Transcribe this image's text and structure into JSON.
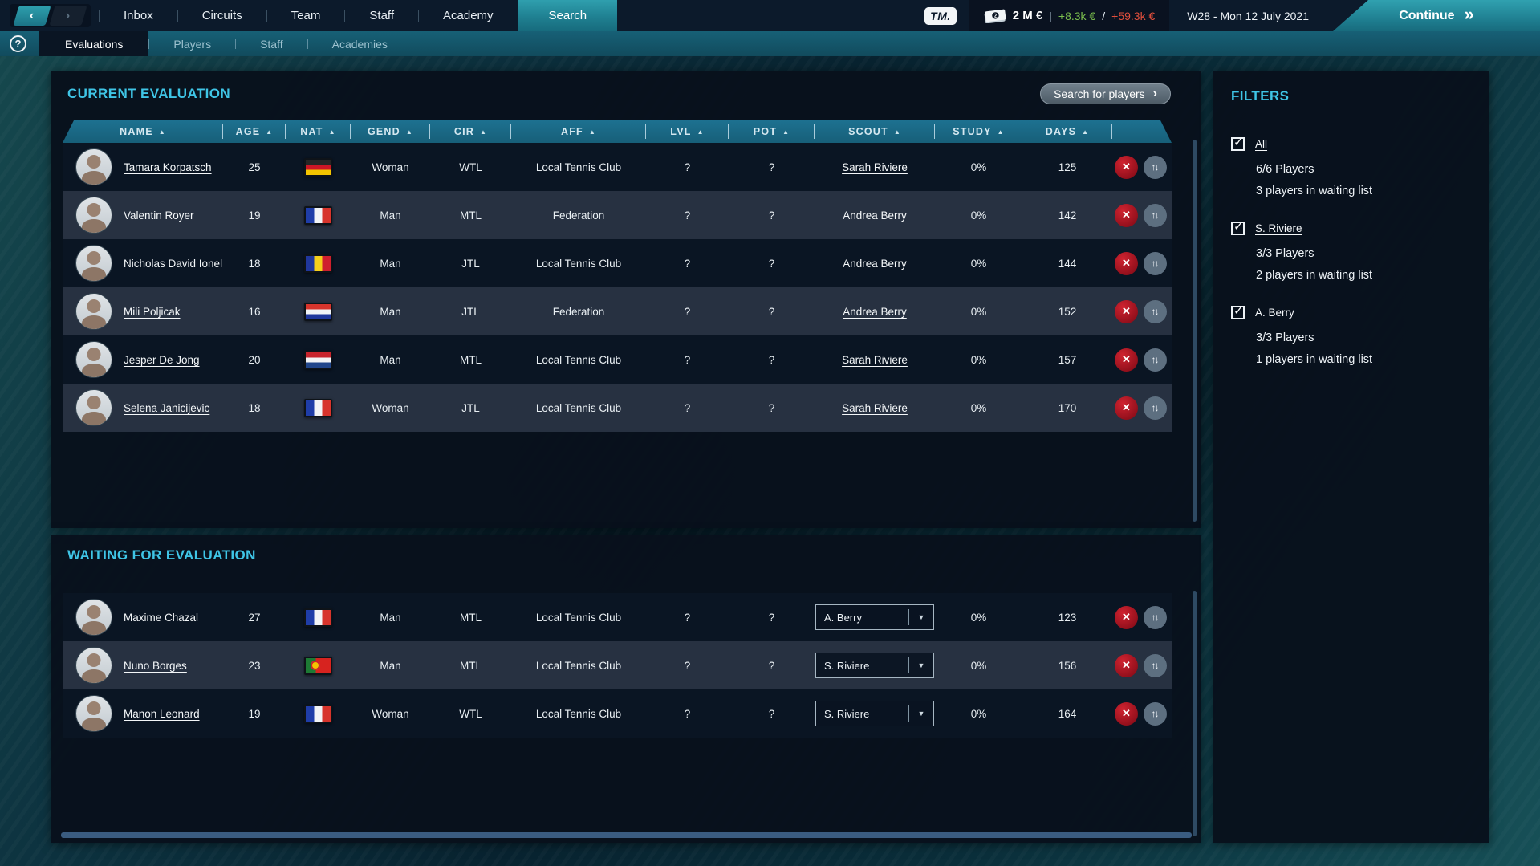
{
  "topbar": {
    "nav_items": [
      "Inbox",
      "Circuits",
      "Team",
      "Staff",
      "Academy",
      "Search"
    ],
    "active_nav": "Search",
    "logo_label": "TM.",
    "balance": "2 M €",
    "pipe": "|",
    "weekly_gain": "+8.3k €",
    "separator": "/",
    "weekly_loss": "+59.3k €",
    "date_label": "W28 - Mon 12 July 2021",
    "continue_label": "Continue",
    "continue_icon": "»",
    "back_icon": "‹",
    "forward_icon": "›"
  },
  "subnav": {
    "help_label": "?",
    "tabs": [
      "Evaluations",
      "Players",
      "Staff",
      "Academies"
    ],
    "active_tab": "Evaluations"
  },
  "current_evaluation": {
    "title": "CURRENT EVALUATION",
    "search_button_label": "Search for players",
    "search_button_icon": "›",
    "sort_icon": "▲",
    "columns": [
      "NAME",
      "AGE",
      "NAT",
      "GEND",
      "CIR",
      "AFF",
      "LVL",
      "POT",
      "SCOUT",
      "STUDY",
      "DAYS"
    ],
    "rows": [
      {
        "name": "Tamara Korpatsch",
        "age": "25",
        "nat": "germany",
        "gend": "Woman",
        "cir": "WTL",
        "aff": "Local Tennis Club",
        "lvl": "?",
        "pot": "?",
        "scout": "Sarah Riviere",
        "study": "0%",
        "days": "125"
      },
      {
        "name": "Valentin Royer",
        "age": "19",
        "nat": "france",
        "gend": "Man",
        "cir": "MTL",
        "aff": "Federation",
        "lvl": "?",
        "pot": "?",
        "scout": "Andrea Berry",
        "study": "0%",
        "days": "142"
      },
      {
        "name": "Nicholas David Ionel",
        "age": "18",
        "nat": "romania",
        "gend": "Man",
        "cir": "JTL",
        "aff": "Local Tennis Club",
        "lvl": "?",
        "pot": "?",
        "scout": "Andrea Berry",
        "study": "0%",
        "days": "144"
      },
      {
        "name": "Mili Poljicak",
        "age": "16",
        "nat": "croatia",
        "gend": "Man",
        "cir": "JTL",
        "aff": "Federation",
        "lvl": "?",
        "pot": "?",
        "scout": "Andrea Berry",
        "study": "0%",
        "days": "152"
      },
      {
        "name": "Jesper De Jong",
        "age": "20",
        "nat": "netherlands",
        "gend": "Man",
        "cir": "MTL",
        "aff": "Local Tennis Club",
        "lvl": "?",
        "pot": "?",
        "scout": "Sarah Riviere",
        "study": "0%",
        "days": "157"
      },
      {
        "name": "Selena Janicijevic",
        "age": "18",
        "nat": "france",
        "gend": "Woman",
        "cir": "JTL",
        "aff": "Local Tennis Club",
        "lvl": "?",
        "pot": "?",
        "scout": "Sarah Riviere",
        "study": "0%",
        "days": "170"
      }
    ]
  },
  "waiting_evaluation": {
    "title": "WAITING FOR EVALUATION",
    "dropdown_icon": "▼",
    "rows": [
      {
        "name": "Maxime Chazal",
        "age": "27",
        "nat": "france",
        "gend": "Man",
        "cir": "MTL",
        "aff": "Local Tennis Club",
        "lvl": "?",
        "pot": "?",
        "scout": "A. Berry",
        "study": "0%",
        "days": "123"
      },
      {
        "name": "Nuno Borges",
        "age": "23",
        "nat": "portugal",
        "gend": "Man",
        "cir": "MTL",
        "aff": "Local Tennis Club",
        "lvl": "?",
        "pot": "?",
        "scout": "S. Riviere",
        "study": "0%",
        "days": "156"
      },
      {
        "name": "Manon Leonard",
        "age": "19",
        "nat": "france",
        "gend": "Woman",
        "cir": "WTL",
        "aff": "Local Tennis Club",
        "lvl": "?",
        "pot": "?",
        "scout": "S. Riviere",
        "study": "0%",
        "days": "164"
      }
    ]
  },
  "filters": {
    "title": "FILTERS",
    "check_icon": "✓",
    "groups": [
      {
        "label": "All",
        "players": "6/6 Players",
        "waiting": "3 players in waiting list",
        "checked": true
      },
      {
        "label": "S. Riviere",
        "players": "3/3 Players",
        "waiting": "2 players in waiting list",
        "checked": true
      },
      {
        "label": "A. Berry",
        "players": "3/3 Players",
        "waiting": "1 players in waiting list",
        "checked": true
      }
    ]
  },
  "action_icons": {
    "remove": "✕",
    "reorder": "↑↓"
  },
  "colors": {
    "accent_cyan": "#3fc5e6",
    "header_teal": "#1a657f",
    "positive_green": "#7cc04e",
    "negative_red": "#e04f3c",
    "delete_red": "#a8101d",
    "reorder_gray": "#5d6f80",
    "continue_teal": "#2a97a6"
  }
}
